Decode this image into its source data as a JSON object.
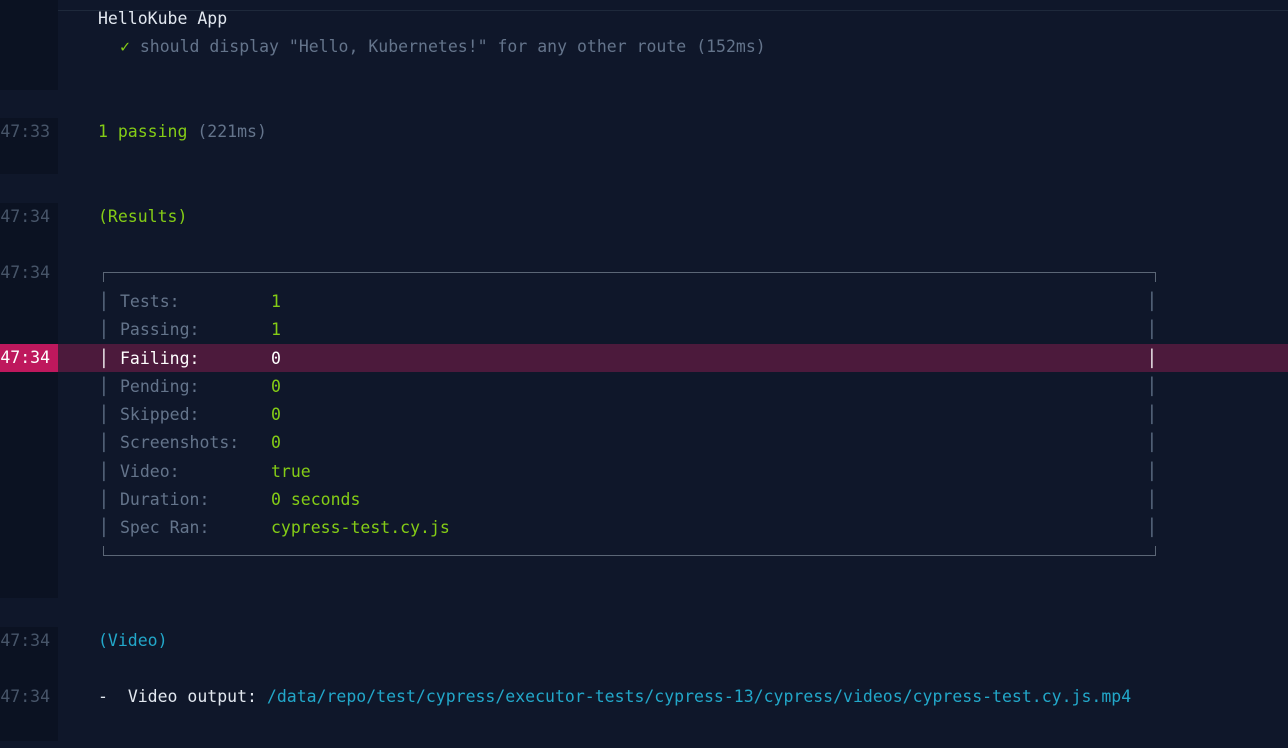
{
  "suite": {
    "name": "HelloKube App",
    "check_mark": "✓",
    "test_title": "should display \"Hello, Kubernetes!\" for any other route",
    "test_duration": "(152ms)"
  },
  "summary": {
    "timestamp": "47:33",
    "passing": "1 passing",
    "duration": "(221ms)"
  },
  "results": {
    "timestamp_header": "47:34",
    "header": "(Results)",
    "timestamp_box": "47:34",
    "timestamp_highlight": "47:34",
    "rows": [
      {
        "label": "Tests:",
        "value": "1"
      },
      {
        "label": "Passing:",
        "value": "1"
      },
      {
        "label": "Failing:",
        "value": "0"
      },
      {
        "label": "Pending:",
        "value": "0"
      },
      {
        "label": "Skipped:",
        "value": "0"
      },
      {
        "label": "Screenshots:",
        "value": "0"
      },
      {
        "label": "Video:",
        "value": "true"
      },
      {
        "label": "Duration:",
        "value": "0 seconds"
      },
      {
        "label": "Spec Ran:",
        "value": "cypress-test.cy.js"
      }
    ]
  },
  "video": {
    "timestamp_header": "47:34",
    "header": "(Video)",
    "timestamp_output": "47:34",
    "bullet": "-",
    "output_label": "Video output:",
    "output_path": "/data/repo/test/cypress/executor-tests/cypress-13/cypress/videos/cypress-test.cy.js.mp4"
  },
  "colors": {
    "background": "#0f172a",
    "highlight_row": "#4c1a3c",
    "highlight_timestamp": "#be185d",
    "success": "#84cc16",
    "link": "#22a7c9"
  }
}
